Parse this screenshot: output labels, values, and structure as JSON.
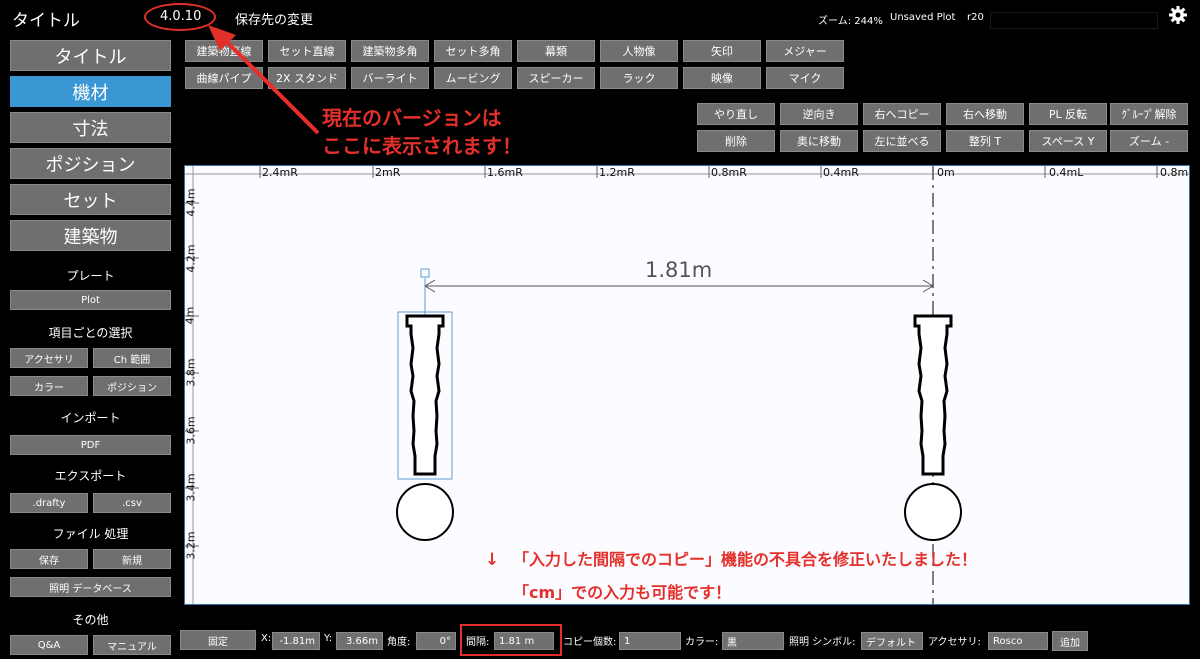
{
  "header": {
    "title": "タイトル",
    "version": "4.0.10",
    "change_save": "保存先の変更",
    "zoom": "ズーム: 244%",
    "plot_status": "Unsaved Plot",
    "revision": "r20"
  },
  "sidebar": {
    "nav": [
      "タイトル",
      "機材",
      "寸法",
      "ポジション",
      "セット",
      "建築物"
    ],
    "active_index": 1,
    "plate_label": "プレート",
    "plot_button": "Plot",
    "select_label": "項目ごとの選択",
    "accessory": "アクセサリ",
    "ch_range": "Ch 範囲",
    "color": "カラー",
    "position": "ポジション",
    "import_label": "インポート",
    "pdf": "PDF",
    "export_label": "エクスポート",
    "drafty": ".drafty",
    "csv": ".csv",
    "file_label": "ファイル 処理",
    "save": "保存",
    "new": "新規",
    "lighting_db": "照明 データベース",
    "other_label": "その他",
    "qa": "Q&A",
    "manual": "マニュアル"
  },
  "toolbar": {
    "row1": [
      "建築物直線",
      "セット直線",
      "建築物多角",
      "セット多角",
      "幕類",
      "人物像",
      "矢印",
      "メジャー"
    ],
    "row2": [
      "曲線パイプ",
      "2X スタンド",
      "バーライト",
      "ムービング",
      "スピーカー",
      "ラック",
      "映像",
      "マイク"
    ],
    "row3": [
      "やり直し",
      "逆向き",
      "右へコピー",
      "右へ移動",
      "PL 反転",
      "ｸﾞﾙｰﾌﾟ解除"
    ],
    "row4": [
      "削除",
      "奥に移動",
      "左に並べる",
      "整列 T",
      "スペース Y",
      "ズーム -"
    ]
  },
  "canvas": {
    "top_ruler": [
      "2.4mR",
      "2mR",
      "1.6mR",
      "1.2mR",
      "0.8mR",
      "0.4mR",
      "0m",
      "0.4mL",
      "0.8mL"
    ],
    "left_ruler": [
      "4.4m",
      "4.2m",
      "4m",
      "3.8m",
      "3.6m",
      "3.4m",
      "3.2m"
    ],
    "dimension": "1.81m"
  },
  "annotations": {
    "version_note_1": "現在のバージョンは",
    "version_note_2": "ここに表示されます！",
    "fix_note": "「入力した間隔でのコピー」機能の不具合を修正いたしました！",
    "arrow_glyph": "↓",
    "cm_note": "「cm」での入力も可能です！"
  },
  "bottombar": {
    "fixed": "固定",
    "x_label": "X:",
    "x_value": "-1.81m",
    "y_label": "Y:",
    "y_value": "3.66m",
    "angle_label": "角度:",
    "angle_value": "0°",
    "spacing_label": "間隔:",
    "spacing_value": "1.81 m",
    "copy_count_label": "コピー個数:",
    "copy_count_value": "1",
    "color_label": "カラー:",
    "color_value": "黒",
    "symbol_label": "照明 シンボル:",
    "symbol_value": "デフォルト",
    "accessory_label": "アクセサリ:",
    "accessory_value": "Rosco",
    "add": "追加"
  },
  "colors": {
    "accent": "#3a97d4",
    "annotation": "#e4302a",
    "button": "#6f6f6f"
  },
  "icons": {
    "settings": "gear-icon"
  }
}
